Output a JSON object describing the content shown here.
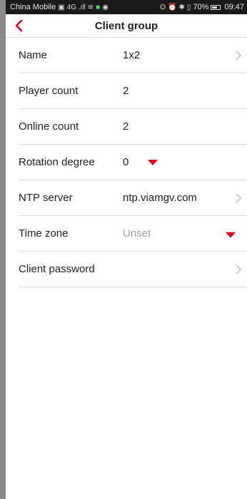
{
  "statusbar": {
    "carrier": "China Mobile",
    "signal": "4G .ıll",
    "battery_pct": "70%",
    "battery_level": 0.7,
    "time": "09:47"
  },
  "header": {
    "title": "Client group"
  },
  "rows": [
    {
      "label": "Name",
      "value": "1x2"
    },
    {
      "label": "Player count",
      "value": "2"
    },
    {
      "label": "Online count",
      "value": "2"
    },
    {
      "label": "Rotation degree",
      "value": "0"
    },
    {
      "label": "NTP server",
      "value": "ntp.viamgv.com"
    },
    {
      "label": "Time zone",
      "value": "Unset"
    },
    {
      "label": "Client password",
      "value": ""
    }
  ],
  "colors": {
    "accent": "#e0001b",
    "text": "#222222",
    "muted": "#a0a0a0",
    "divider": "#dcdcdc"
  }
}
